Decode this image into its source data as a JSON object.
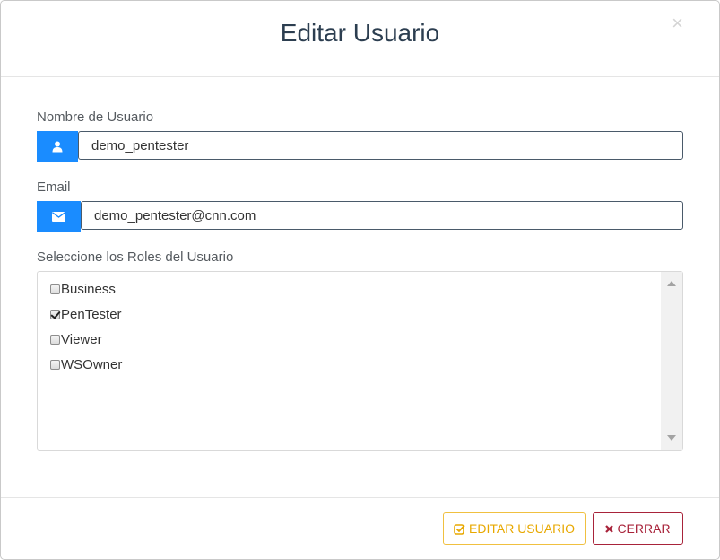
{
  "modal": {
    "title": "Editar Usuario",
    "close_symbol": "×"
  },
  "form": {
    "username": {
      "label": "Nombre de Usuario",
      "value": "demo_pentester",
      "icon": "user-icon"
    },
    "email": {
      "label": "Email",
      "value": "demo_pentester@cnn.com",
      "icon": "envelope-icon"
    },
    "roles": {
      "label": "Seleccione los Roles del Usuario",
      "items": [
        {
          "label": "Business",
          "checked": false
        },
        {
          "label": "PenTester",
          "checked": true
        },
        {
          "label": "Viewer",
          "checked": false
        },
        {
          "label": "WSOwner",
          "checked": false
        }
      ]
    }
  },
  "footer": {
    "edit_label": "EDITAR USUARIO",
    "edit_icon": "check-square-icon",
    "close_label": "CERRAR",
    "close_icon": "times-icon"
  },
  "colors": {
    "accent_blue": "#1a8cff",
    "edit_yellow": "#e8a800",
    "close_red": "#a8233a",
    "title": "#2c3e50"
  }
}
